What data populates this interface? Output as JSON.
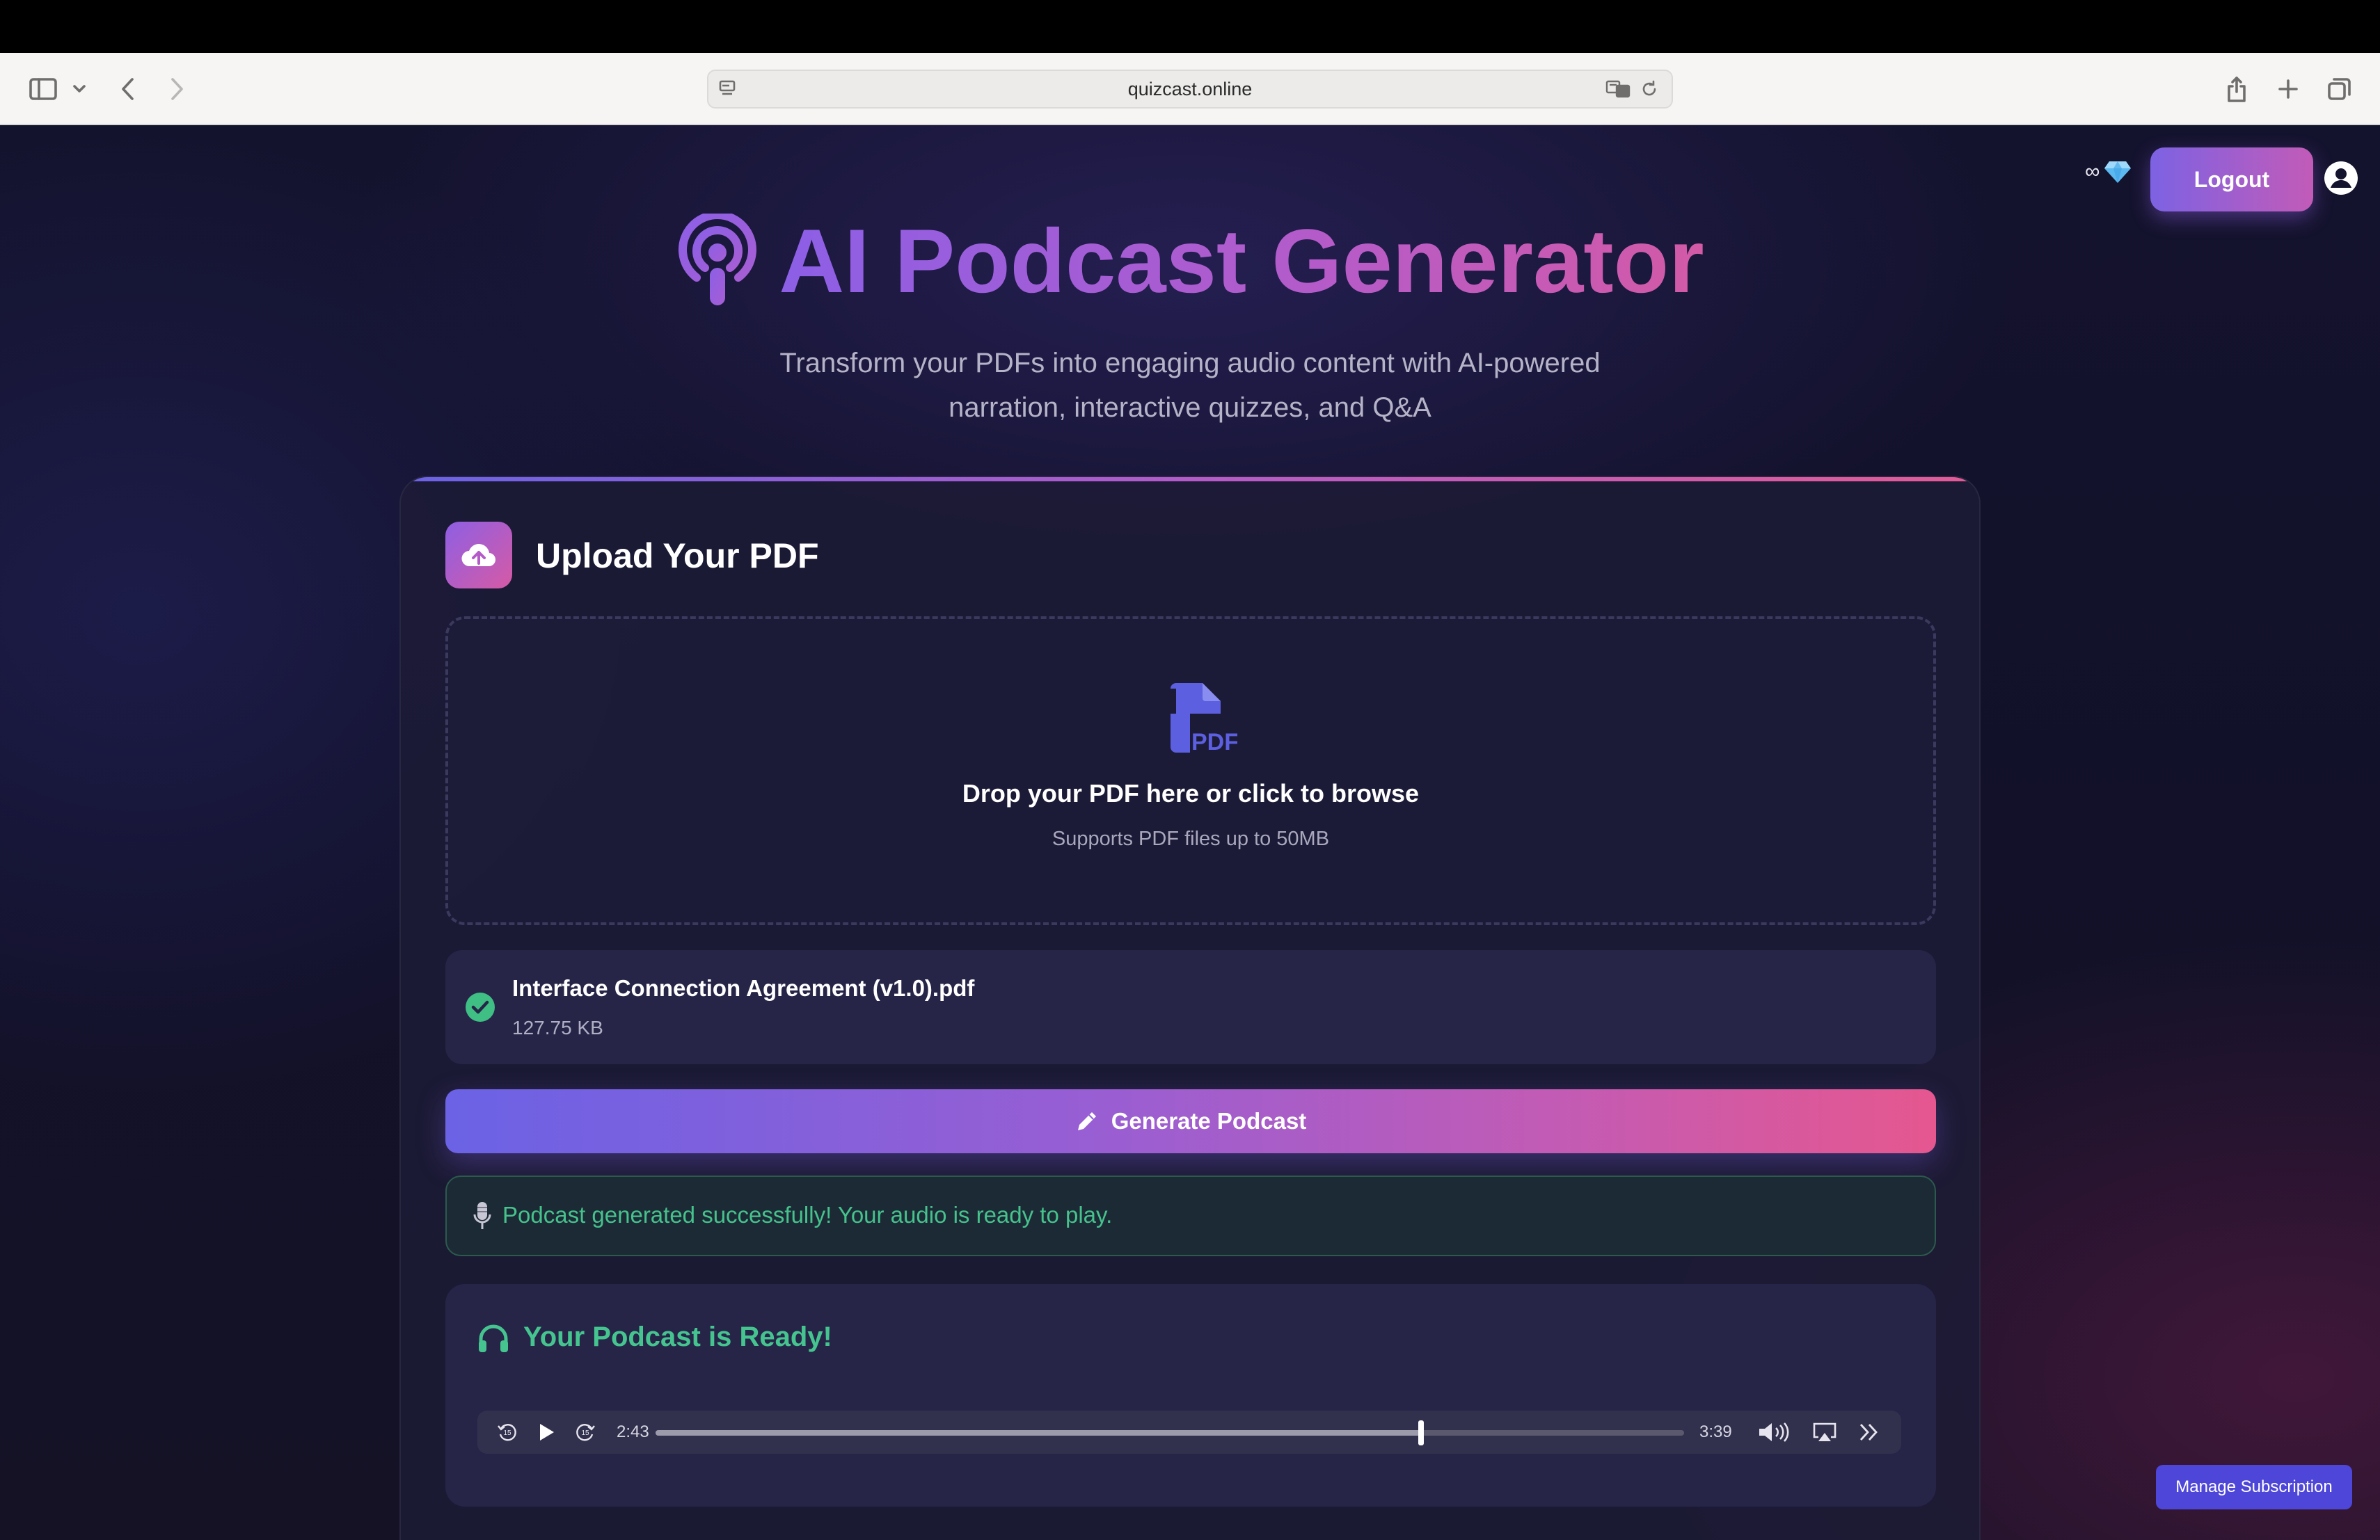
{
  "browser": {
    "url": "quizcast.online"
  },
  "header": {
    "credits": "∞",
    "credits_icon": "gem-icon",
    "logout_label": "Logout"
  },
  "hero": {
    "title": "AI Podcast Generator",
    "subtitle": "Transform your PDFs into engaging audio content with AI-powered narration, interactive quizzes, and Q&A"
  },
  "upload": {
    "title": "Upload Your PDF",
    "drop_text": "Drop your PDF here or click to browse",
    "drop_hint": "Supports PDF files up to 50MB",
    "pdf_badge": "PDF"
  },
  "file": {
    "name": "Interface Connection Agreement (v1.0).pdf",
    "size": "127.75 KB"
  },
  "generate_label": "Generate Podcast",
  "success_message": "Podcast generated successfully! Your audio is ready to play.",
  "player": {
    "title": "Your Podcast is Ready!",
    "current_time": "2:43",
    "duration": "3:39",
    "progress": 0.744,
    "skip_seconds": "15"
  },
  "manage_label": "Manage Subscription",
  "colors": {
    "accent_purple": "#8c5fe6",
    "accent_pink": "#e5578f",
    "success_green": "#46c28c"
  }
}
